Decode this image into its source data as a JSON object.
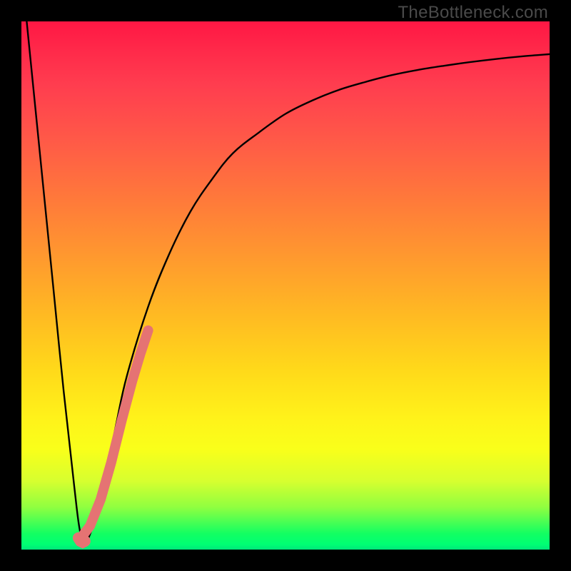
{
  "watermark": "TheBottleneck.com",
  "chart_data": {
    "type": "line",
    "title": "",
    "xlabel": "",
    "ylabel": "",
    "xlim": [
      0,
      100
    ],
    "ylim": [
      0,
      100
    ],
    "series": [
      {
        "name": "bottleneck-curve",
        "x": [
          0,
          2,
          4,
          6,
          8,
          10,
          11,
          12,
          14,
          16,
          18,
          20,
          24,
          28,
          32,
          36,
          40,
          45,
          50,
          55,
          60,
          65,
          70,
          75,
          80,
          85,
          90,
          95,
          100
        ],
        "values": [
          110,
          90,
          70,
          50,
          30,
          12,
          4,
          1,
          6,
          14,
          24,
          33,
          46,
          56,
          64,
          70,
          75,
          79,
          82.5,
          85,
          87,
          88.5,
          89.8,
          90.8,
          91.6,
          92.3,
          92.9,
          93.4,
          93.8
        ]
      },
      {
        "name": "highlight-segment",
        "x": [
          11.5,
          13.0,
          15.0,
          17.0,
          19.0,
          21.0,
          22.5,
          24.0
        ],
        "values": [
          2.5,
          4.5,
          9.5,
          16.5,
          24.5,
          32.0,
          37.0,
          41.5
        ]
      },
      {
        "name": "highlight-tip",
        "x": [
          10.8,
          11.2,
          11.6,
          12.0
        ],
        "values": [
          2.2,
          1.6,
          1.4,
          1.6
        ]
      }
    ],
    "colors": {
      "curve": "#000000",
      "highlight": "#e57373"
    }
  }
}
